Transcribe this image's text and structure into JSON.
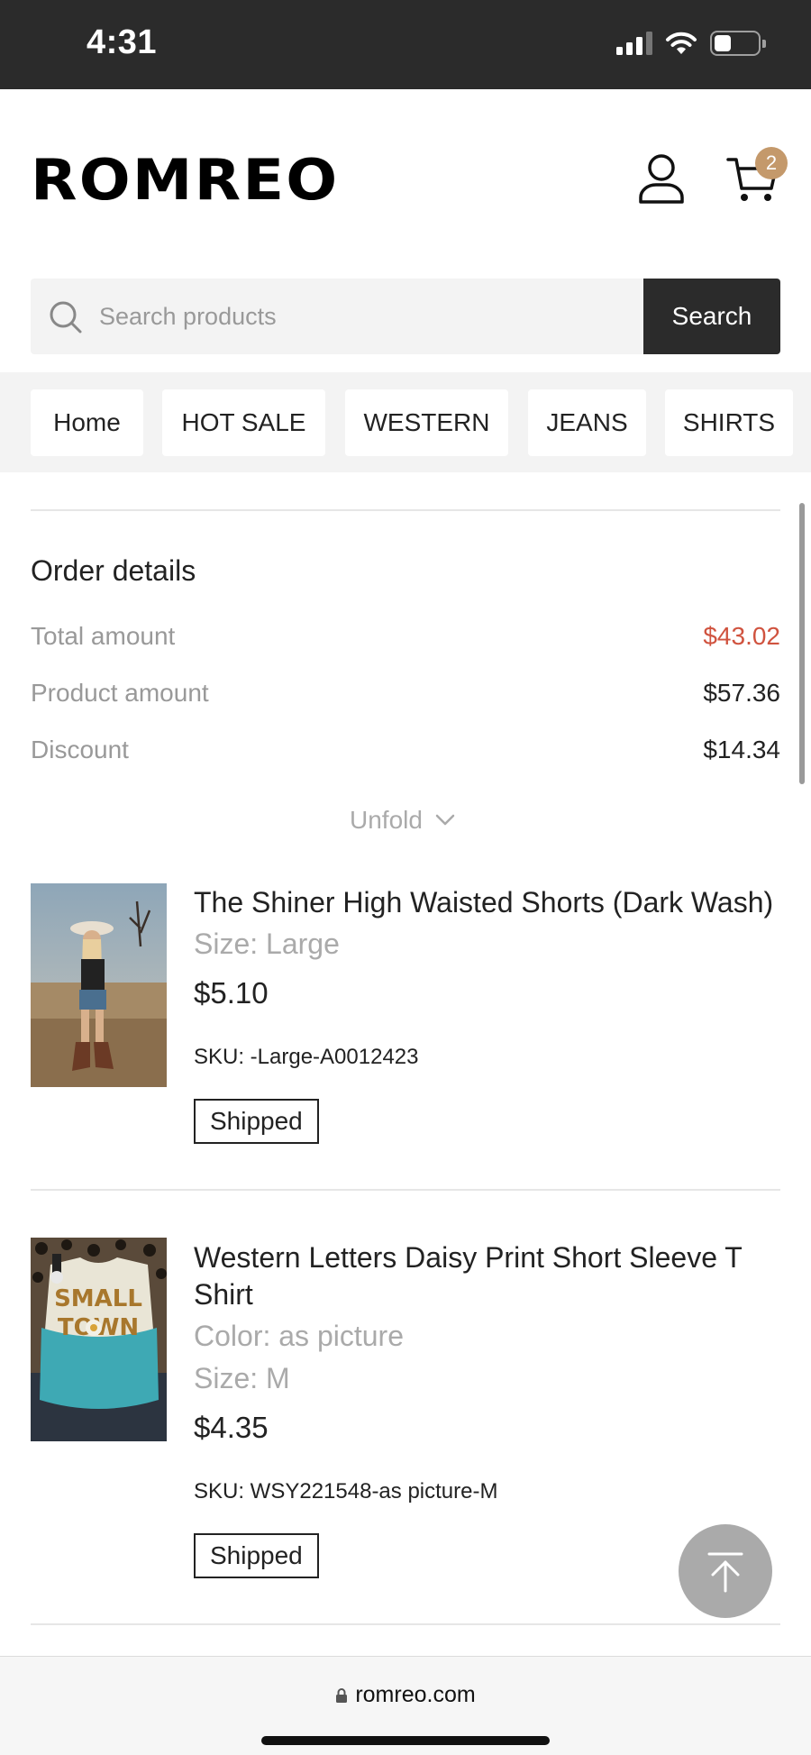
{
  "status_bar": {
    "time": "4:31"
  },
  "header": {
    "logo": "ROMREO",
    "cart_count": "2"
  },
  "search": {
    "placeholder": "Search products",
    "button_label": "Search"
  },
  "nav": {
    "items": [
      "Home",
      "HOT SALE",
      "WESTERN",
      "JEANS",
      "SHIRTS"
    ]
  },
  "order_details": {
    "title": "Order details",
    "rows": [
      {
        "label": "Total amount",
        "value": "$43.02"
      },
      {
        "label": "Product amount",
        "value": "$57.36"
      },
      {
        "label": "Discount",
        "value": "$14.34"
      }
    ],
    "unfold_label": "Unfold"
  },
  "products": [
    {
      "title": "The Shiner High Waisted Shorts (Dark Wash)",
      "attributes": [
        "Size: Large"
      ],
      "price": "$5.10",
      "sku": "SKU: -Large-A0012423",
      "status": "Shipped"
    },
    {
      "title": "Western Letters Daisy Print Short Sleeve T Shirt",
      "attributes": [
        "Color: as picture",
        "Size: M"
      ],
      "price": "$4.35",
      "sku": "SKU: WSY221548-as picture-M",
      "status": "Shipped"
    }
  ],
  "browser": {
    "url": "romreo.com"
  },
  "colors": {
    "accent_price": "#d0533f",
    "badge": "#c4996b",
    "dark": "#2b2b2b"
  },
  "icons": [
    "signal-icon",
    "wifi-icon",
    "battery-icon",
    "account-icon",
    "cart-icon",
    "search-icon",
    "chevron-down-icon",
    "arrow-up-icon",
    "lock-icon"
  ]
}
